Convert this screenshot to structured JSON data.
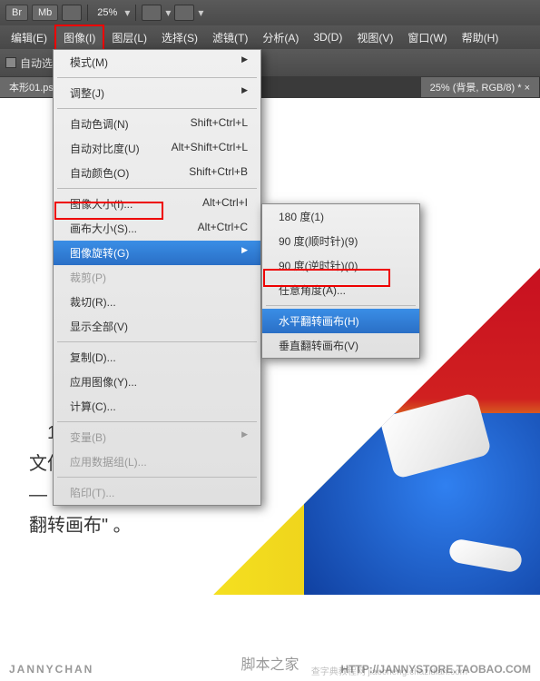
{
  "toolbar": {
    "br": "Br",
    "mb": "Mb",
    "zoom": "25%"
  },
  "menubar": {
    "edit": "编辑(E)",
    "image": "图像(I)",
    "layer": "图层(L)",
    "select": "选择(S)",
    "filter": "滤镜(T)",
    "analysis": "分析(A)",
    "threed": "3D(D)",
    "view": "视图(V)",
    "window": "窗口(W)",
    "help": "帮助(H)"
  },
  "optbar": {
    "autoselect": "自动选"
  },
  "tabs": {
    "left": "本形01.ps",
    "right": "25% (背景, RGB/8) * ×"
  },
  "image_menu": [
    {
      "label": "模式(M)",
      "shortcut": "",
      "arrow": true
    },
    {
      "sep": true
    },
    {
      "label": "调整(J)",
      "shortcut": "",
      "arrow": true
    },
    {
      "sep": true
    },
    {
      "label": "自动色调(N)",
      "shortcut": "Shift+Ctrl+L"
    },
    {
      "label": "自动对比度(U)",
      "shortcut": "Alt+Shift+Ctrl+L"
    },
    {
      "label": "自动颜色(O)",
      "shortcut": "Shift+Ctrl+B"
    },
    {
      "sep": true
    },
    {
      "label": "图像大小(I)...",
      "shortcut": "Alt+Ctrl+I"
    },
    {
      "label": "画布大小(S)...",
      "shortcut": "Alt+Ctrl+C"
    },
    {
      "label": "图像旋转(G)",
      "shortcut": "",
      "arrow": true,
      "sel": true
    },
    {
      "label": "裁剪(P)",
      "shortcut": "",
      "dis": true
    },
    {
      "label": "裁切(R)...",
      "shortcut": ""
    },
    {
      "label": "显示全部(V)",
      "shortcut": ""
    },
    {
      "sep": true
    },
    {
      "label": "复制(D)...",
      "shortcut": ""
    },
    {
      "label": "应用图像(Y)...",
      "shortcut": ""
    },
    {
      "label": "计算(C)...",
      "shortcut": ""
    },
    {
      "sep": true
    },
    {
      "label": "变量(B)",
      "shortcut": "",
      "arrow": true,
      "dis": true
    },
    {
      "label": "应用数据组(L)...",
      "shortcut": "",
      "dis": true
    },
    {
      "sep": true
    },
    {
      "label": "陷印(T)...",
      "shortcut": "",
      "dis": true
    }
  ],
  "rotate_menu": [
    {
      "label": "180 度(1)"
    },
    {
      "label": "90 度(顺时针)(9)"
    },
    {
      "label": "90 度(逆时针)(0)"
    },
    {
      "label": "任意角度(A)..."
    },
    {
      "sep": true
    },
    {
      "label": "水平翻转画布(H)",
      "sel": true
    },
    {
      "label": "垂直翻转画布(V)"
    }
  ],
  "caption": "　18、在 \"基本形01\" 文件中，点选 \"图像\" — \"图像旋转\" — \"水平翻转画布\" 。",
  "footer": {
    "name": "JANNYCHAN",
    "url": "HTTP://JANNYSTORE.TAOBAO.COM"
  },
  "watermark": "脚本之家",
  "wm2": "查字典教程网 jiaocheng.chazidian.com"
}
